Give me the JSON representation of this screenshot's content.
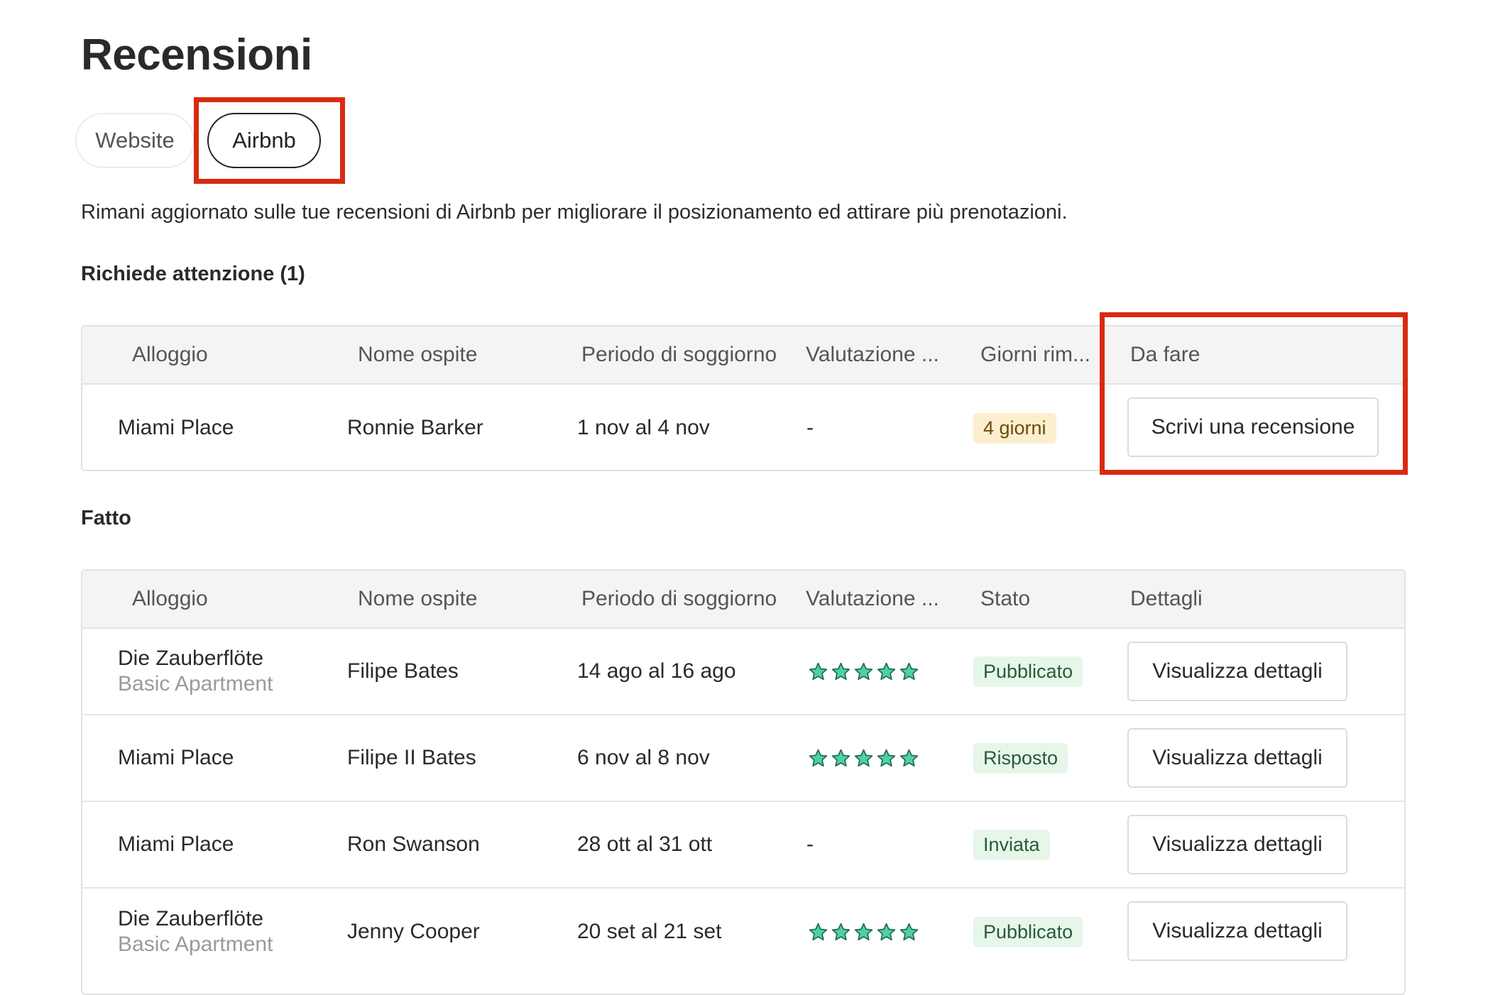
{
  "page": {
    "title": "Recensioni",
    "description": "Rimani aggiornato sulle tue recensioni di Airbnb per migliorare il posizionamento ed attirare più prenotazioni."
  },
  "tabs": [
    {
      "label": "Website",
      "active": false
    },
    {
      "label": "Airbnb",
      "active": true
    }
  ],
  "attention": {
    "title": "Richiede attenzione (1)",
    "columns": [
      "Alloggio",
      "Nome ospite",
      "Periodo di soggiorno",
      "Valutazione ...",
      "Giorni rim...",
      "Da fare"
    ],
    "rows": [
      {
        "property": "Miami Place",
        "guest": "Ronnie Barker",
        "period": "1 nov al 4 nov",
        "rating": "-",
        "days_left": "4 giorni",
        "action": "Scrivi una recensione"
      }
    ]
  },
  "done": {
    "title": "Fatto",
    "columns": [
      "Alloggio",
      "Nome ospite",
      "Periodo di soggiorno",
      "Valutazione ...",
      "Stato",
      "Dettagli"
    ],
    "rows": [
      {
        "property": "Die Zauberflöte",
        "unit": "Basic Apartment",
        "guest": "Filipe Bates",
        "period": "14 ago al 16 ago",
        "stars": 5,
        "status": "Pubblicato",
        "action": "Visualizza dettagli"
      },
      {
        "property": "Miami Place",
        "unit": "",
        "guest": "Filipe II Bates",
        "period": "6 nov al 8 nov",
        "stars": 5,
        "status": "Risposto",
        "action": "Visualizza dettagli"
      },
      {
        "property": "Miami Place",
        "unit": "",
        "guest": "Ron Swanson",
        "period": "28 ott al 31 ott",
        "rating_text": "-",
        "status": "Inviata",
        "action": "Visualizza dettagli"
      },
      {
        "property": "Die Zauberflöte",
        "unit": "Basic Apartment",
        "guest": "Jenny Cooper",
        "period": "20 set al 21 set",
        "stars": 5,
        "status": "Pubblicato",
        "action": "Visualizza dettagli"
      }
    ]
  },
  "colors": {
    "highlight": "#d82a10",
    "star_fill": "#4fd1a5",
    "star_stroke": "#1f6b4f"
  }
}
